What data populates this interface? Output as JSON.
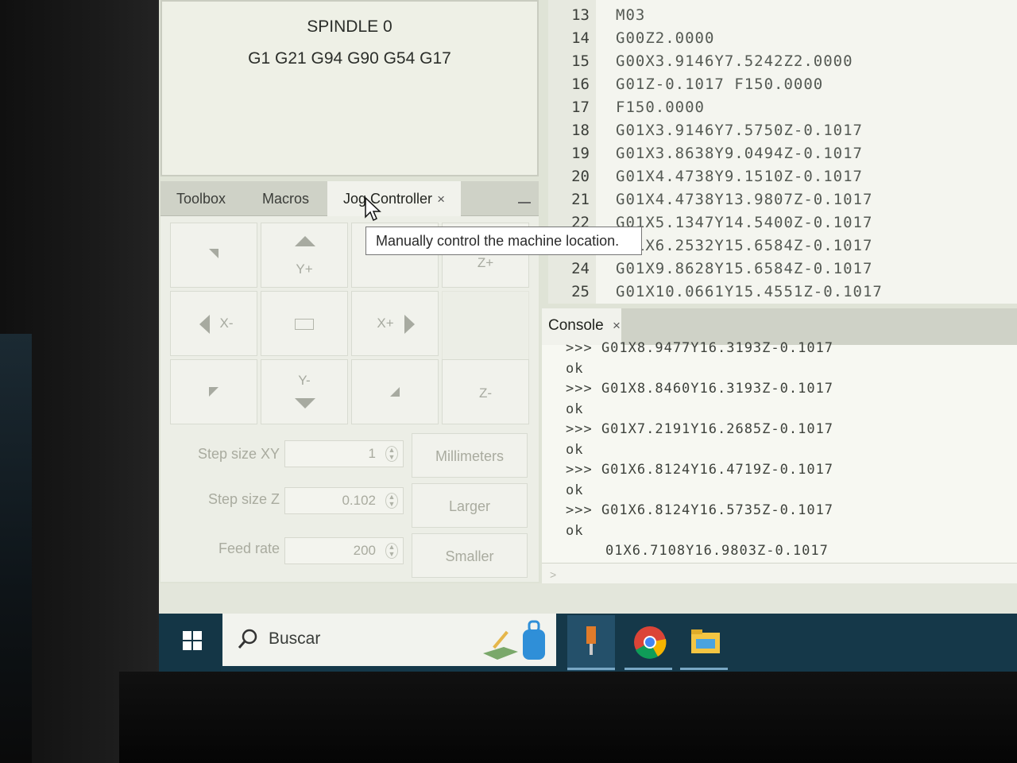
{
  "status": {
    "spindle": "SPINDLE 0",
    "modal_state": "G1 G21 G94 G90 G54 G17"
  },
  "tabs": {
    "toolbox": "Toolbox",
    "macros": "Macros",
    "jog_controller": "Jog Controller",
    "close_glyph": "×"
  },
  "tooltip": "Manually control the machine location.",
  "jog": {
    "y_plus": "Y+",
    "y_minus": "Y-",
    "x_plus": "X+",
    "x_minus": "X-",
    "z_plus": "Z+",
    "z_minus": "Z-",
    "step_xy_label": "Step size XY",
    "step_xy_value": "1",
    "step_z_label": "Step size Z",
    "step_z_value": "0.102",
    "feed_label": "Feed rate",
    "feed_value": "200",
    "units_button": "Millimeters",
    "larger_button": "Larger",
    "smaller_button": "Smaller"
  },
  "editor": {
    "lines": [
      {
        "n": "13",
        "code": "M03"
      },
      {
        "n": "14",
        "code": "G00Z2.0000"
      },
      {
        "n": "15",
        "code": "G00X3.9146Y7.5242Z2.0000"
      },
      {
        "n": "16",
        "code": "G01Z-0.1017 F150.0000"
      },
      {
        "n": "17",
        "code": "F150.0000"
      },
      {
        "n": "18",
        "code": "G01X3.9146Y7.5750Z-0.1017"
      },
      {
        "n": "19",
        "code": "G01X3.8638Y9.0494Z-0.1017"
      },
      {
        "n": "20",
        "code": "G01X4.4738Y9.1510Z-0.1017"
      },
      {
        "n": "21",
        "code": "G01X4.4738Y13.9807Z-0.1017"
      },
      {
        "n": "22",
        "code": "G01X5.1347Y14.5400Z-0.1017"
      },
      {
        "n": "23",
        "code": "G01X6.2532Y15.6584Z-0.1017"
      },
      {
        "n": "24",
        "code": "G01X9.8628Y15.6584Z-0.1017"
      },
      {
        "n": "25",
        "code": "G01X10.0661Y15.4551Z-0.1017"
      }
    ]
  },
  "console": {
    "tab_label": "Console",
    "lines": [
      ">>> G01X8.9477Y16.3193Z-0.1017",
      "ok",
      ">>> G01X8.8460Y16.3193Z-0.1017",
      "ok",
      ">>> G01X7.2191Y16.2685Z-0.1017",
      "ok",
      ">>> G01X6.8124Y16.4719Z-0.1017",
      "ok",
      ">>> G01X6.8124Y16.5735Z-0.1017",
      "ok",
      "01X6.7108Y16.9803Z-0.1017"
    ],
    "input_prompt": ">"
  },
  "taskbar": {
    "search_label": "Buscar"
  },
  "colors": {
    "taskbar": "#153849",
    "panel": "#eef0e6",
    "tab_bar": "#cfd2c7"
  }
}
